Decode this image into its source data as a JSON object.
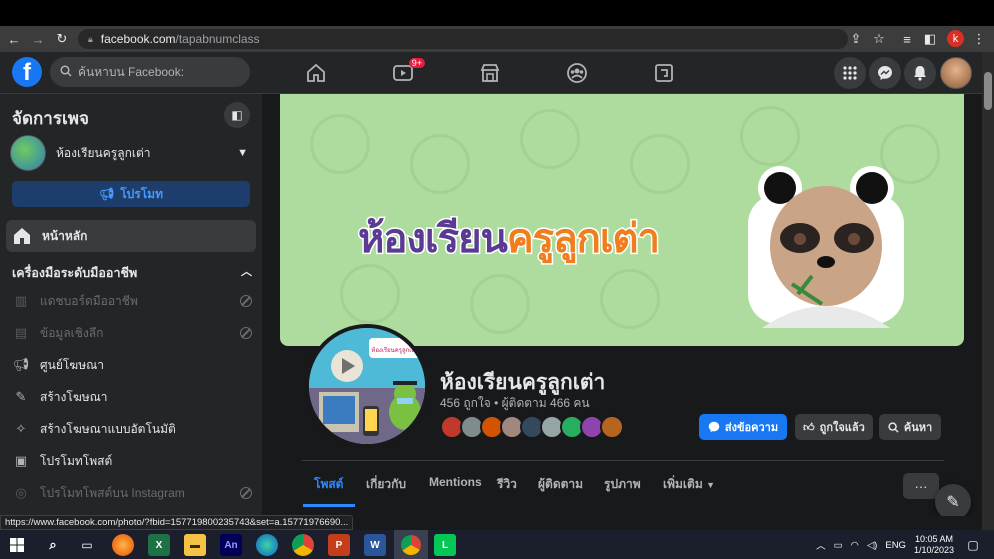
{
  "browser": {
    "url_host": "facebook.com",
    "url_path": "/tapabnumclass",
    "profile_initial": "k"
  },
  "header": {
    "search_placeholder": "ค้นหาบน Facebook:",
    "watch_badge": "9+"
  },
  "sidebar": {
    "title": "จัดการเพจ",
    "page_name": "ห้องเรียนครูลูกเต่า",
    "promote_label": "โปรโมท",
    "home_label": "หน้าหลัก",
    "tools_heading": "เครื่องมือระดับมืออาชีพ",
    "items": [
      {
        "label": "แดชบอร์ดมืออาชีพ",
        "icon": "chart-icon",
        "disabled": true
      },
      {
        "label": "ข้อมูลเชิงลึก",
        "icon": "insights-icon",
        "disabled": true
      },
      {
        "label": "ศูนย์โฆษณา",
        "icon": "megaphone-icon",
        "disabled": false
      },
      {
        "label": "สร้างโฆษณา",
        "icon": "edit-icon",
        "disabled": false
      },
      {
        "label": "สร้างโฆษณาแบบอัตโนมัติ",
        "icon": "magic-wand-icon",
        "disabled": false
      },
      {
        "label": "โปรโมทโพสต์",
        "icon": "promote-post-icon",
        "disabled": false
      },
      {
        "label": "โปรโมทโพสต์บน Instagram",
        "icon": "instagram-icon",
        "disabled": true
      }
    ]
  },
  "cover": {
    "text_purple": "ห้องเรียน",
    "text_orange": "ครูลูกเต่า"
  },
  "profile": {
    "name": "ห้องเรียนครูลูกเต่า",
    "stats": "456 ถูกใจ • ผู้ติดตาม 466 คน",
    "pic_caption": "ห้องเรียนครูลูกเต่า"
  },
  "actions": {
    "message": "ส่งข้อความ",
    "liked": "ถูกใจแล้ว",
    "search": "ค้นหา"
  },
  "tabs": [
    "โพสต์",
    "เกี่ยวกับ",
    "Mentions",
    "รีวิว",
    "ผู้ติดตาม",
    "รูปภาพ",
    "เพิ่มเติม"
  ],
  "status_url": "https://www.facebook.com/photo/?fbid=157719800235743&set=a.15771976690...",
  "taskbar": {
    "lang": "ENG",
    "time": "10:05 AM",
    "date": "1/10/2023"
  },
  "colors": {
    "fb_blue": "#1877f2",
    "cover_green": "#aedc9f",
    "title_purple": "#5b3a93",
    "title_orange": "#f07d1e"
  }
}
